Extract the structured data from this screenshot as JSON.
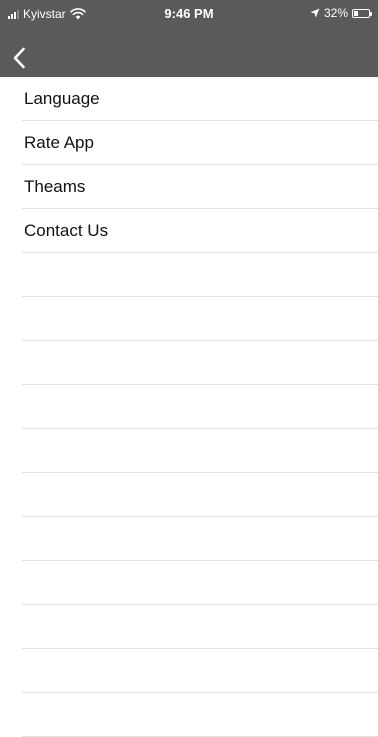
{
  "status_bar": {
    "carrier": "Kyivstar",
    "time": "9:46 PM",
    "battery": "32%",
    "battery_level": 0.32
  },
  "nav": {
    "back_icon": "chevron-left-icon"
  },
  "menu": {
    "items": [
      {
        "label": "Language"
      },
      {
        "label": "Rate App"
      },
      {
        "label": "Theams"
      },
      {
        "label": "Contact Us"
      }
    ]
  },
  "colors": {
    "nav_bar": "#5a5a5a",
    "separator": "#e3e3e3"
  }
}
